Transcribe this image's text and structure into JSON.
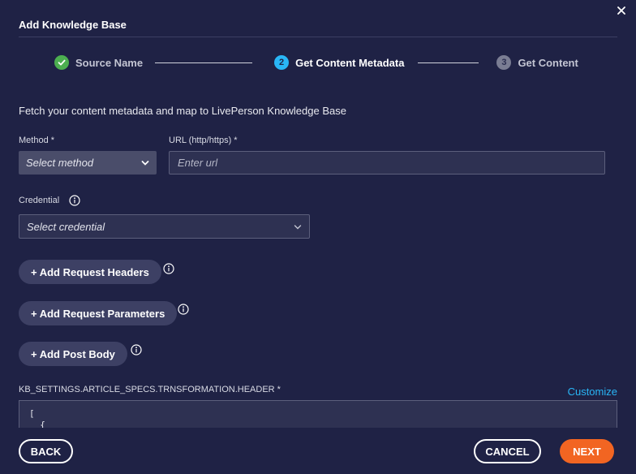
{
  "dialog": {
    "title": "Add Knowledge Base",
    "close_icon": "close-icon"
  },
  "stepper": {
    "steps": [
      {
        "label": "Source Name",
        "state": "done",
        "marker": "✓"
      },
      {
        "label": "Get Content Metadata",
        "state": "active",
        "marker": "2"
      },
      {
        "label": "Get Content",
        "state": "pending",
        "marker": "3"
      }
    ]
  },
  "form": {
    "description": "Fetch your content metadata and map to LivePerson Knowledge Base",
    "method": {
      "label": "Method *",
      "placeholder": "Select method"
    },
    "url": {
      "label": "URL (http/https) *",
      "placeholder": "Enter url"
    },
    "credential": {
      "label": "Credential",
      "placeholder": "Select credential"
    },
    "add_headers_label": "+ Add Request Headers",
    "add_params_label": "+ Add Request Parameters",
    "add_post_body_label": "+ Add Post Body",
    "header_field": {
      "label": "KB_SETTINGS.ARTICLE_SPECS.TRNSFORMATION.HEADER *",
      "customize_label": "Customize",
      "code_lines": [
        "[",
        "  {"
      ]
    }
  },
  "footer": {
    "back_label": "BACK",
    "cancel_label": "CANCEL",
    "next_label": "NEXT"
  },
  "colors": {
    "background": "#1f2245",
    "accent": "#29b6f6",
    "success": "#4caf50",
    "primary_button": "#f26522"
  }
}
